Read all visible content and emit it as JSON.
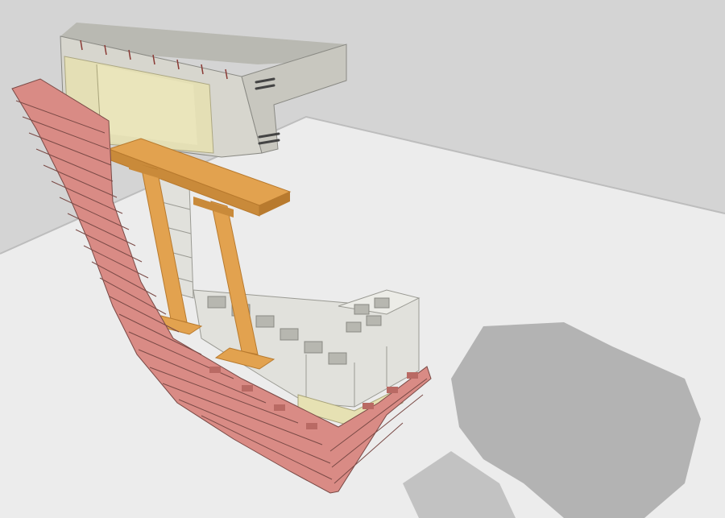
{
  "scene": {
    "subject": "wall-assembly-cutaway",
    "colors": {
      "backdrop": "#cfcfcf",
      "floor": "#ececec",
      "shadow": "#a9a9a9",
      "brick": "#d98b85",
      "brick_dark": "#b96a64",
      "mortar": "#7a4a46",
      "cmu": "#e1e1dc",
      "cmu_dark": "#9a9a93",
      "slab_top": "#b9b9b2",
      "slab_side": "#d7d6ce",
      "insulation": "#e6e1b3",
      "wood": "#e2a24f",
      "wood_dark": "#b87a2e"
    }
  }
}
